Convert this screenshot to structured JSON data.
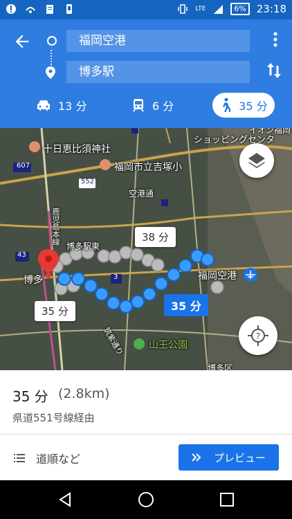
{
  "status_bar": {
    "battery": "6%",
    "time": "23:18",
    "network": "LTE"
  },
  "directions": {
    "origin": "福岡空港",
    "destination": "博多駅"
  },
  "modes": [
    {
      "name": "car",
      "label": "13 分"
    },
    {
      "name": "transit",
      "label": "6 分"
    },
    {
      "name": "walk",
      "label": "35 分"
    }
  ],
  "map": {
    "labels": {
      "shrine": "十日恵比須神社",
      "school": "福岡市立吉塚小",
      "shopping": "ショッピングセンタ",
      "shopping_top": "イオン福岡",
      "airport_line": "空港通",
      "hakata_east": "博多駅東",
      "airport": "福岡空港",
      "hakata": "博多",
      "park": "山王公園",
      "road_607": "607",
      "road_552": "552",
      "road_43": "43",
      "road_3": "3",
      "kagoshima": "鹿児島本線",
      "chikushi": "筑紫通り",
      "hakata2": "博多区"
    },
    "route_alt_time": "38 分",
    "route_time": "35 分",
    "start_time": "35 分"
  },
  "summary": {
    "duration": "35 分",
    "distance": "(2.8km)",
    "via": "県道551号線経由"
  },
  "actions": {
    "steps_label": "道順など",
    "preview_label": "プレビュー"
  }
}
